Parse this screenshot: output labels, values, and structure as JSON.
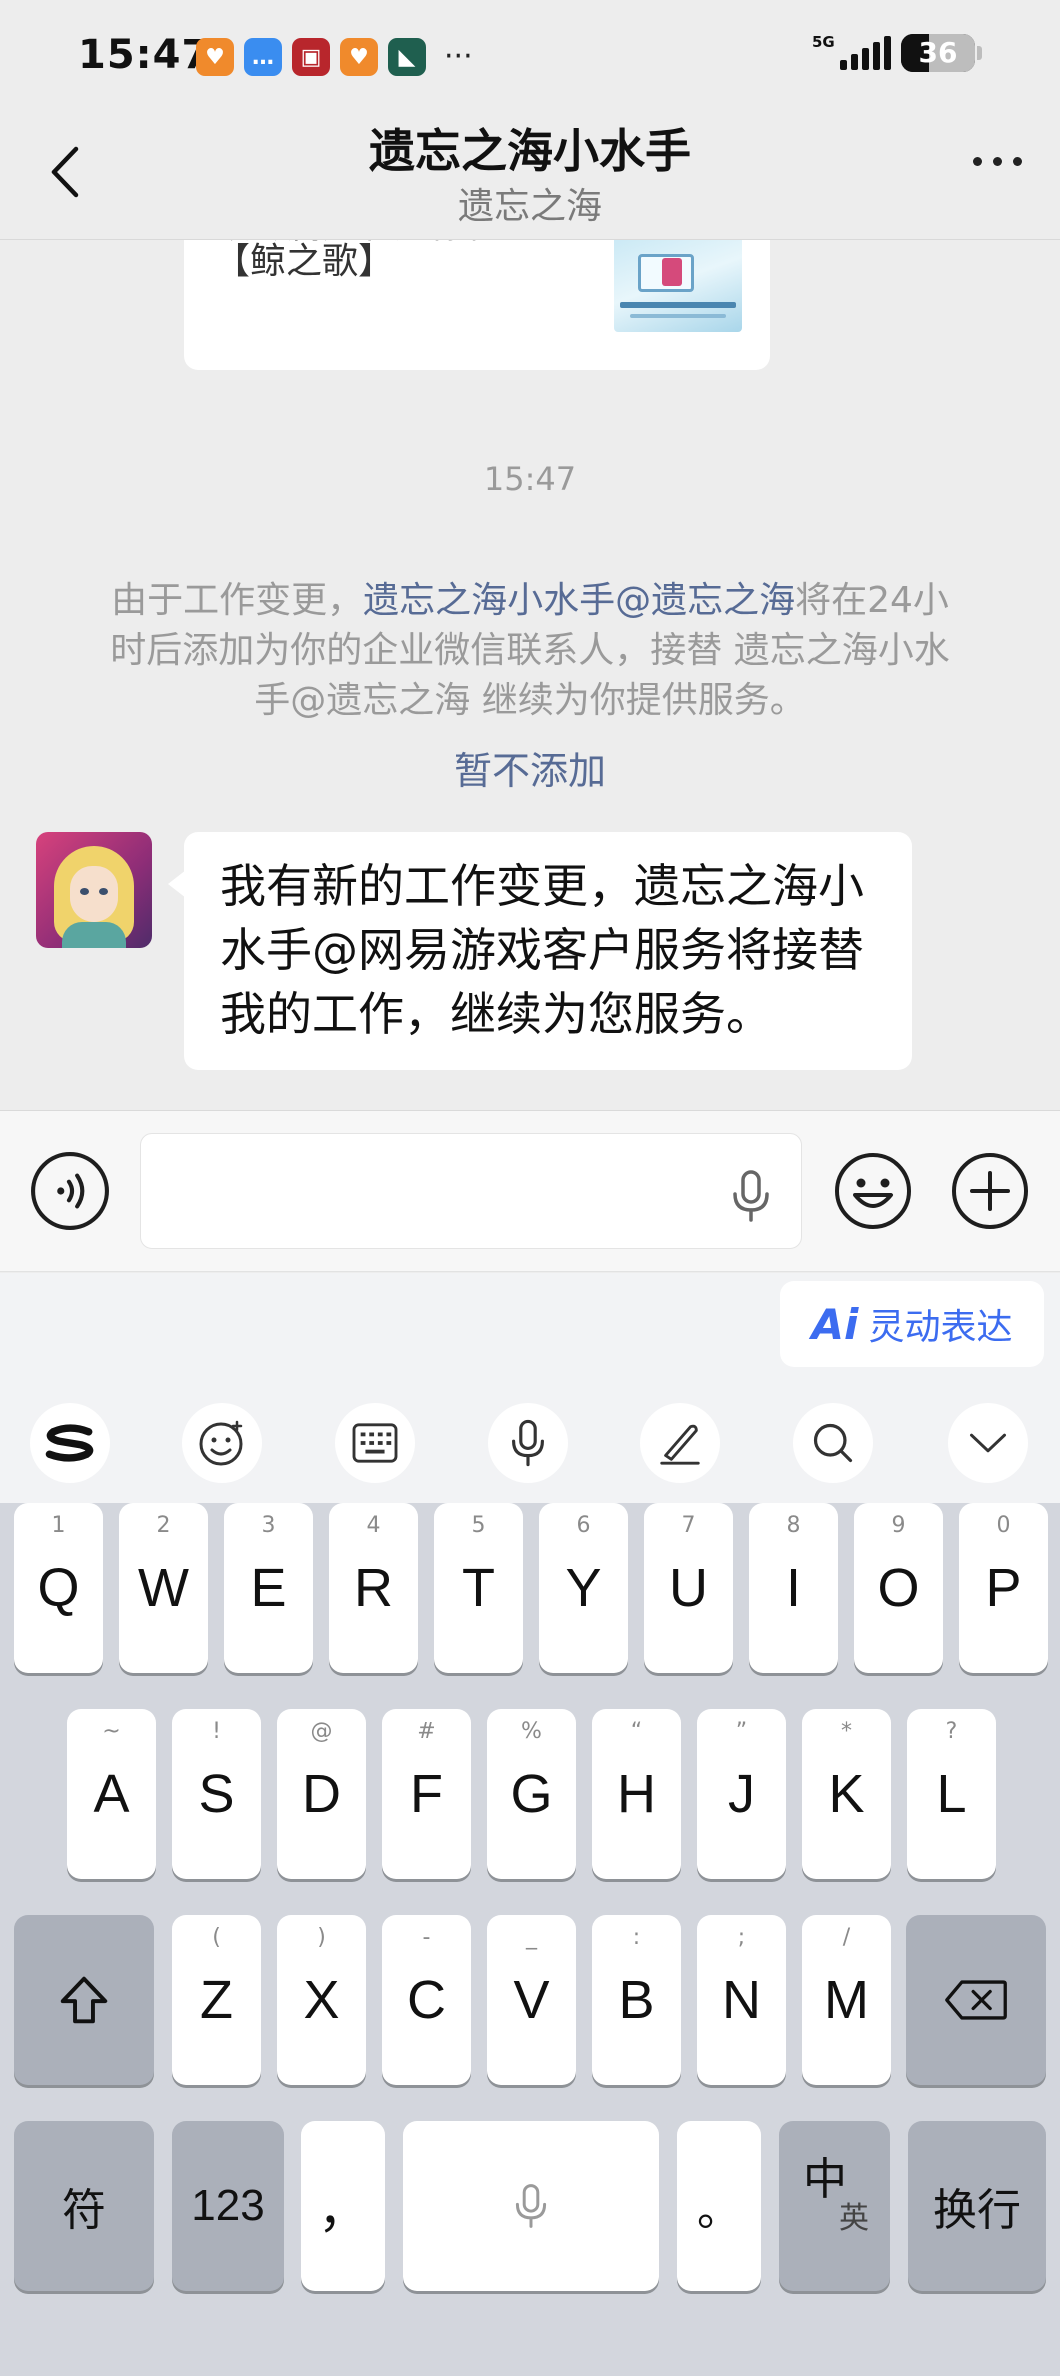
{
  "status_bar": {
    "time": "15:47",
    "more": "···",
    "network": "5G",
    "battery": "36"
  },
  "header": {
    "title": "遗忘之海小水手",
    "subtitle": "遗忘之海"
  },
  "chat": {
    "card": {
      "line1": "领专属定制头像框",
      "line2": "【鲸之歌】"
    },
    "timestamp": "15:47",
    "system_notice": {
      "prefix": "由于工作变更，",
      "link": "遗忘之海小水手@遗忘之海",
      "suffix": "将在24小时后添加为你的企业微信联系人，接替 遗忘之海小水手@遗忘之海 继续为你提供服务。",
      "action": "暂不添加"
    },
    "message": "我有新的工作变更，遗忘之海小水手@网易游戏客户服务将接替我的工作，继续为您服务。"
  },
  "keyboard": {
    "smart_ai": "Ai",
    "smart_label": "灵动表达",
    "row1": [
      {
        "k": "Q",
        "h": "1"
      },
      {
        "k": "W",
        "h": "2"
      },
      {
        "k": "E",
        "h": "3"
      },
      {
        "k": "R",
        "h": "4"
      },
      {
        "k": "T",
        "h": "5"
      },
      {
        "k": "Y",
        "h": "6"
      },
      {
        "k": "U",
        "h": "7"
      },
      {
        "k": "I",
        "h": "8"
      },
      {
        "k": "O",
        "h": "9"
      },
      {
        "k": "P",
        "h": "0"
      }
    ],
    "row2": [
      {
        "k": "A",
        "h": "~"
      },
      {
        "k": "S",
        "h": "!"
      },
      {
        "k": "D",
        "h": "@"
      },
      {
        "k": "F",
        "h": "#"
      },
      {
        "k": "G",
        "h": "%"
      },
      {
        "k": "H",
        "h": "“"
      },
      {
        "k": "J",
        "h": "”"
      },
      {
        "k": "K",
        "h": "*"
      },
      {
        "k": "L",
        "h": "?"
      }
    ],
    "row3": [
      {
        "k": "Z",
        "h": "("
      },
      {
        "k": "X",
        "h": ")"
      },
      {
        "k": "C",
        "h": "-"
      },
      {
        "k": "V",
        "h": "_"
      },
      {
        "k": "B",
        "h": ":"
      },
      {
        "k": "N",
        "h": ";"
      },
      {
        "k": "M",
        "h": "/"
      }
    ],
    "symbols": "符",
    "numbers": "123",
    "comma": "，",
    "period": "。",
    "lang_main": "中",
    "lang_sub": "英",
    "enter": "换行"
  }
}
